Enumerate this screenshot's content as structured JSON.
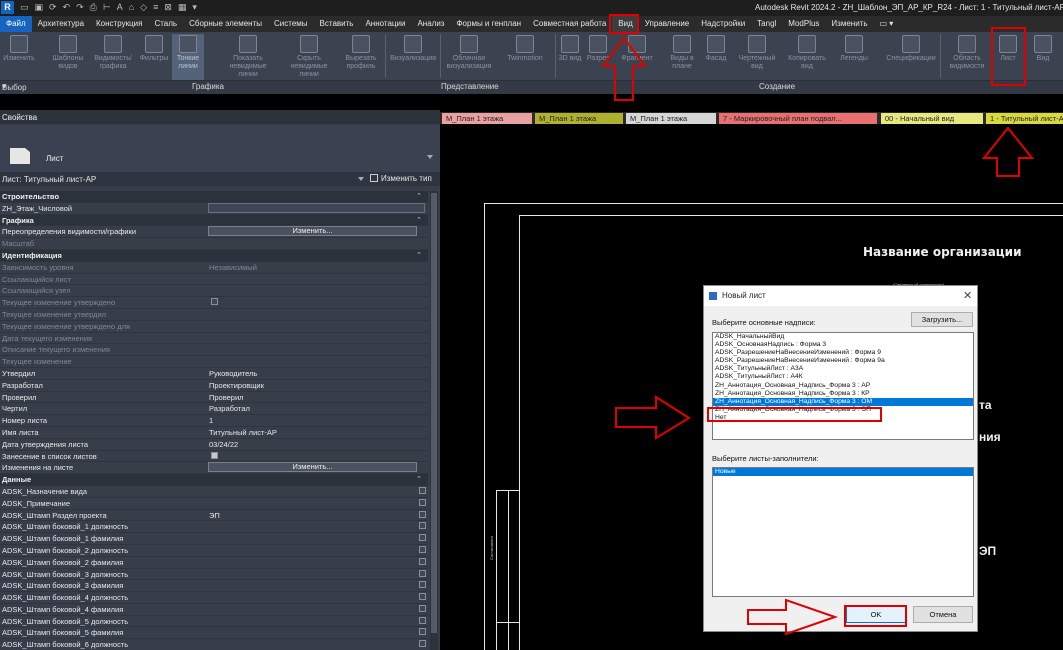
{
  "title_bar": {
    "logo": "R",
    "title": "Autodesk Revit 2024.2 - ZH_Шаблон_ЭП_АР_КР_R24 - Лист: 1 - Титульный лист-АР"
  },
  "menu": {
    "tabs": [
      "Файл",
      "Архитектура",
      "Конструкция",
      "Сталь",
      "Сборные элементы",
      "Системы",
      "Вставить",
      "Аннотации",
      "Анализ",
      "Формы и генплан",
      "Совместная работа",
      "Вид",
      "Управление",
      "Надстройки",
      "Tangl",
      "ModPlus",
      "Изменить"
    ],
    "active_tab": "Вид"
  },
  "ribbon": {
    "buttons": [
      "Изменить",
      "Шаблоны видов",
      "Видимость/ графика",
      "Фильтры",
      "Тонкие линии",
      "Показать невидимые линии",
      "Скрыть невидимые линии",
      "Вырезать профиль",
      "Визуализация",
      "Облачная визуализация",
      "Twinmotion",
      "3D вид",
      "Разрез",
      "Фрагмент",
      "Виды в плане",
      "Фасад",
      "Чертежный вид",
      "Копировать вид",
      "Легенды",
      "Спецификации",
      "Область видимости",
      "Лист",
      "Вид"
    ],
    "panels": [
      "Выбор",
      "Графика",
      "Представление",
      "Создание"
    ]
  },
  "properties": {
    "title": "Свойства",
    "type_name": "Лист",
    "selector": "Лист: Титульный лист-АР",
    "edit_type": "Изменить тип",
    "rows": [
      {
        "kind": "group",
        "label": "Строительство"
      },
      {
        "kind": "input",
        "label": "ZH_Этаж_Числовой",
        "value": ""
      },
      {
        "kind": "group",
        "label": "Графика"
      },
      {
        "kind": "button",
        "label": "Переопределения видимости/графики",
        "value": "Изменить..."
      },
      {
        "kind": "dim",
        "label": "Масштаб",
        "value": ""
      },
      {
        "kind": "group",
        "label": "Идентификация"
      },
      {
        "kind": "dim",
        "label": "Зависимость уровня",
        "value": "Независимый"
      },
      {
        "kind": "dim",
        "label": "Ссылающийся лист",
        "value": ""
      },
      {
        "kind": "dim",
        "label": "Ссылающийся узел",
        "value": ""
      },
      {
        "kind": "dimchk",
        "label": "Текущее изменение утверждено",
        "value": ""
      },
      {
        "kind": "dim",
        "label": "Текущее изменение утвердил",
        "value": ""
      },
      {
        "kind": "dim",
        "label": "Текущее изменение утверждено для",
        "value": ""
      },
      {
        "kind": "dim",
        "label": "Дата текущего изменения",
        "value": ""
      },
      {
        "kind": "dim",
        "label": "Описание текущего изменения",
        "value": ""
      },
      {
        "kind": "dim",
        "label": "Текущее изменение",
        "value": ""
      },
      {
        "kind": "text",
        "label": "Утвердил",
        "value": "Руководитель"
      },
      {
        "kind": "text",
        "label": "Разработал",
        "value": "Проектировщик"
      },
      {
        "kind": "text",
        "label": "Проверил",
        "value": "Проверил"
      },
      {
        "kind": "text",
        "label": "Чертил",
        "value": "Разработал"
      },
      {
        "kind": "text",
        "label": "Номер листа",
        "value": "1"
      },
      {
        "kind": "text",
        "label": "Имя листа",
        "value": "Титульный лист-АР"
      },
      {
        "kind": "text",
        "label": "Дата утверждения листа",
        "value": "03/24/22"
      },
      {
        "kind": "checkon",
        "label": "Занесение в список листов",
        "value": ""
      },
      {
        "kind": "button",
        "label": "Изменения на листе",
        "value": "Изменить..."
      },
      {
        "kind": "group",
        "label": "Данные"
      },
      {
        "kind": "rchk",
        "label": "ADSK_Назначение вида",
        "value": ""
      },
      {
        "kind": "rchk",
        "label": "ADSK_Примечание",
        "value": ""
      },
      {
        "kind": "rchk",
        "label": "ADSK_Штамп Раздел проекта",
        "value": "ЭП"
      },
      {
        "kind": "rchk",
        "label": "ADSK_Штамп боковой_1 должность",
        "value": ""
      },
      {
        "kind": "rchk",
        "label": "ADSK_Штамп боковой_1 фамилия",
        "value": ""
      },
      {
        "kind": "rchk",
        "label": "ADSK_Штамп боковой_2 должность",
        "value": ""
      },
      {
        "kind": "rchk",
        "label": "ADSK_Штамп боковой_2 фамилия",
        "value": ""
      },
      {
        "kind": "rchk",
        "label": "ADSK_Штамп боковой_3 должность",
        "value": ""
      },
      {
        "kind": "rchk",
        "label": "ADSK_Штамп боковой_3 фамилия",
        "value": ""
      },
      {
        "kind": "rchk",
        "label": "ADSK_Штамп боковой_4 должность",
        "value": ""
      },
      {
        "kind": "rchk",
        "label": "ADSK_Штамп боковой_4 фамилия",
        "value": ""
      },
      {
        "kind": "rchk",
        "label": "ADSK_Штамп боковой_5 должность",
        "value": ""
      },
      {
        "kind": "rchk",
        "label": "ADSK_Штамп боковой_5 фамилия",
        "value": ""
      },
      {
        "kind": "rchk",
        "label": "ADSK_Штамп боковой_6 должность",
        "value": ""
      }
    ]
  },
  "view_tabs": [
    {
      "label": "М_План 1 этажа",
      "color": "#e8a0a0"
    },
    {
      "label": "М_План 1 этажа",
      "color": "#b0b030"
    },
    {
      "label": "М_План 1 этажа",
      "color": "#d6d6d6"
    },
    {
      "label": "7 - Маркировочный план подвал...",
      "color": "#e87070"
    },
    {
      "label": "00 - Начальный вид",
      "color": "#e8e880"
    },
    {
      "label": "1 - Титульный лист-АР",
      "color": "#d8d840"
    }
  ],
  "drawing": {
    "org_name": "Название организации",
    "org_sub": "(Сведения об организации)",
    "partial_text_1": "та",
    "partial_text_2": "ния",
    "partial_text_3": "ЭП",
    "side_stamp": "Согласовано"
  },
  "dialog": {
    "title": "Новый лист",
    "close": "✕",
    "title_blocks_label": "Выберите основные надписи:",
    "load_button": "Загрузить...",
    "title_blocks": [
      "ADSK_НачальныйВид",
      "ADSK_ОсновнаяНадпись : Форма 3",
      "ADSK_РазрешениеНаВнесениеИзменений : Форма 9",
      "ADSK_РазрешениеНаВнесениеИзменений : Форма 9а",
      "ADSK_ТитульныйЛист : А3А",
      "ADSK_ТитульныйЛист : А4К",
      "ZH_Аннотация_Основная_Надпись_Форма 3 : АР",
      "ZH_Аннотация_Основная_Надпись_Форма 3 : КР",
      "ZH_Аннотация_Основная_Надпись_Форма 3 : ОМ",
      "ZH_Аннотация_Основная_Надпись_Форма 3 : ЭП",
      "Нет"
    ],
    "selected_index": 8,
    "placeholder_label": "Выберите листы-заполнители:",
    "placeholders": [
      "Новые"
    ],
    "ok": "OK",
    "cancel": "Отмена"
  },
  "colors": {
    "annotation_red": "#e00000",
    "selection_blue": "#0078d7",
    "ribbon_bg": "#3b4250"
  }
}
